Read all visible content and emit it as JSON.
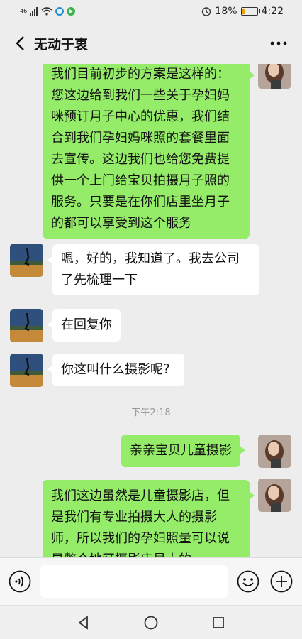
{
  "status": {
    "time": "4:22",
    "battery": "18%",
    "network": "46"
  },
  "header": {
    "title": "无动于衷"
  },
  "messages": [
    {
      "side": "right",
      "text": "我们目前初步的方案是这样的：您这边给到我们一些关于孕妇妈咪预订月子中心的优惠，我们结合到我们孕妇妈咪照的套餐里面去宣传。这边我们也给您免费提供一个上门给宝贝拍摄月子照的服务。只要是在你们店里坐月子的都可以享受到这个服务"
    },
    {
      "side": "left",
      "text": "嗯，好的，我知道了。我去公司了先梳理一下"
    },
    {
      "side": "left",
      "text": "在回复你"
    },
    {
      "side": "left",
      "text": "你这叫什么摄影呢？"
    },
    {
      "side": "right",
      "text": "亲亲宝贝儿童摄影"
    },
    {
      "side": "right",
      "text": "我们这边虽然是儿童摄影店，但是我们有专业拍摄大人的摄影师，所以我们的孕妇照量可以说是整个地区摄影店最大的"
    }
  ],
  "timestamp": "下午2:18",
  "input": {
    "placeholder": ""
  },
  "colors": {
    "self_bubble": "#95ec69",
    "other_bubble": "#ffffff",
    "background": "#ededed"
  }
}
